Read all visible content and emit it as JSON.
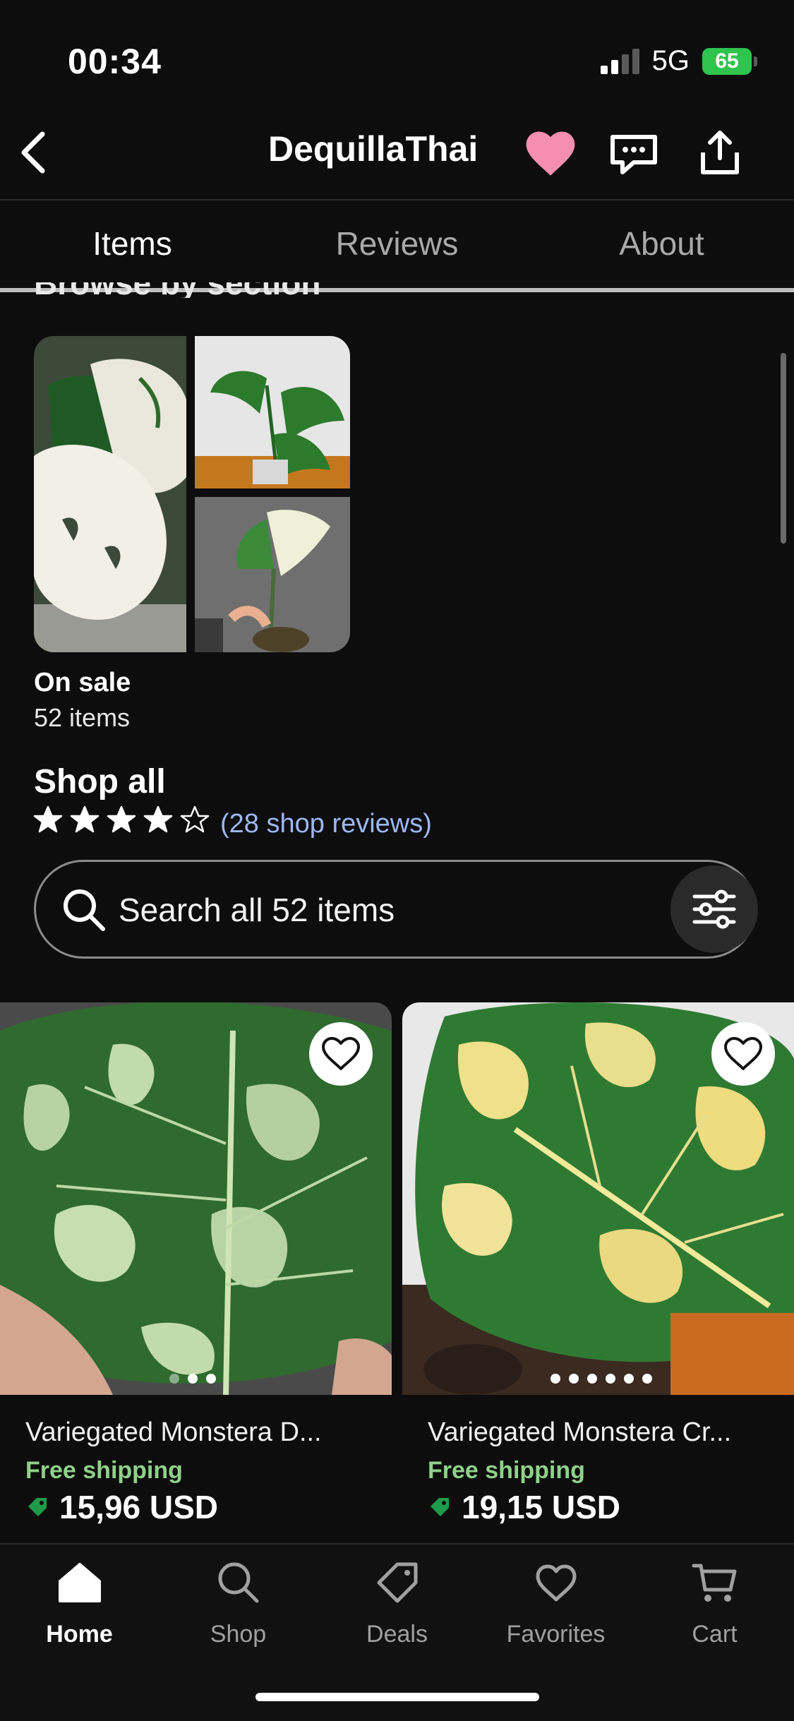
{
  "status": {
    "time": "00:34",
    "network": "5G",
    "battery": "65"
  },
  "header": {
    "title": "DequillaThai"
  },
  "tabs": [
    {
      "label": "Items"
    },
    {
      "label": "Reviews"
    },
    {
      "label": "About"
    }
  ],
  "section_heading_partial": "Browse by section",
  "section": {
    "title": "On sale",
    "count": "52 items"
  },
  "shop_all": {
    "title": "Shop all",
    "rating": 4,
    "rating_max": 5,
    "reviews_link": "(28 shop reviews)"
  },
  "search": {
    "placeholder": "Search all 52 items"
  },
  "products": [
    {
      "title": "Variegated Monstera D...",
      "shipping": "Free shipping",
      "price": "15,96 USD",
      "image_count": 3,
      "active_image": 1
    },
    {
      "title": "Variegated Monstera Cr...",
      "shipping": "Free shipping",
      "price": "19,15 USD",
      "image_count": 6,
      "active_image": 1
    }
  ],
  "nav": [
    {
      "label": "Home",
      "icon": "home-icon",
      "active": true
    },
    {
      "label": "Shop",
      "icon": "search-icon",
      "active": false
    },
    {
      "label": "Deals",
      "icon": "tag-icon",
      "active": false
    },
    {
      "label": "Favorites",
      "icon": "heart-icon",
      "active": false
    },
    {
      "label": "Cart",
      "icon": "cart-icon",
      "active": false
    }
  ],
  "colors": {
    "accent_heart": "#f48fb1",
    "shipping_green": "#8fd18a",
    "link_blue": "#9db7f2",
    "tag_green": "#1f9a4a"
  }
}
